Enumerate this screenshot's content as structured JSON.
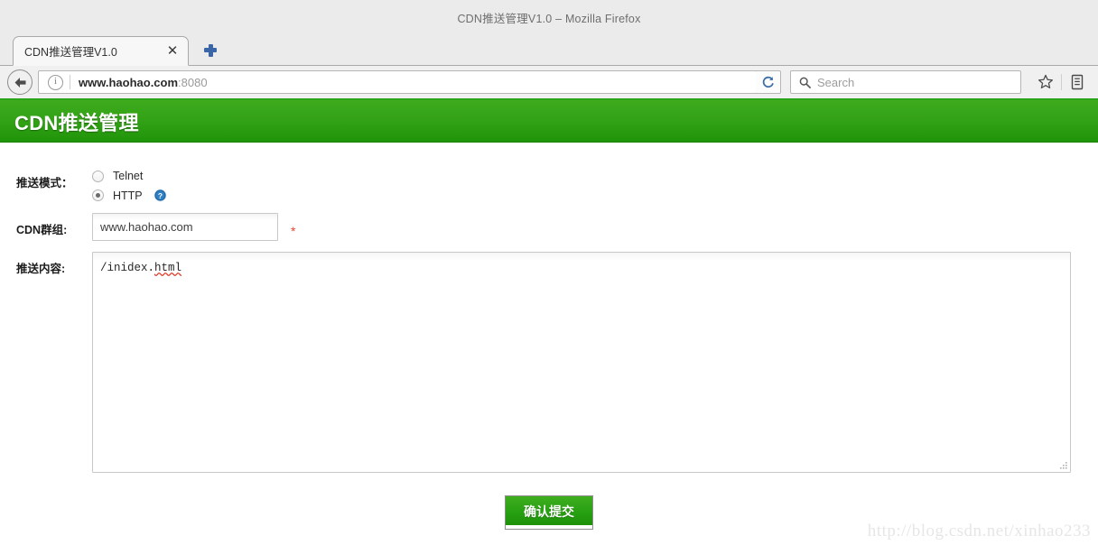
{
  "window": {
    "title": "CDN推送管理V1.0 – Mozilla Firefox"
  },
  "tabbar": {
    "tabs": [
      {
        "title": "CDN推送管理V1.0",
        "close_label": "✕"
      }
    ],
    "new_tab_label": "+"
  },
  "navbar": {
    "back_label": "←",
    "info_label": "i",
    "url_scheme": "",
    "url_host": "www.haohao.com",
    "url_port": ":8080",
    "url_full": "www.haohao.com:8080",
    "reload_label": "⟳",
    "search_placeholder": "Search",
    "search_value": "",
    "bookmark_label": "☆",
    "library_label": "▤"
  },
  "page": {
    "header_title": "CDN推送管理",
    "header_color": "#2ba41b",
    "form": {
      "mode": {
        "label": "推送模式：",
        "options": [
          {
            "label": "Telnet",
            "checked": false
          },
          {
            "label": "HTTP",
            "checked": true
          }
        ],
        "help_tooltip": "?"
      },
      "group": {
        "label": "CDN群组:",
        "value": "www.haohao.com",
        "placeholder": "",
        "required_mark": "*",
        "required_color": "#e8442c"
      },
      "content": {
        "label": "推送内容:",
        "value": "/inidex.html",
        "value_prefix": "/inidex.",
        "value_misspelled": "html",
        "placeholder": ""
      },
      "submit": {
        "label": "确认提交"
      }
    },
    "watermark": "http://blog.csdn.net/xinhao233"
  }
}
